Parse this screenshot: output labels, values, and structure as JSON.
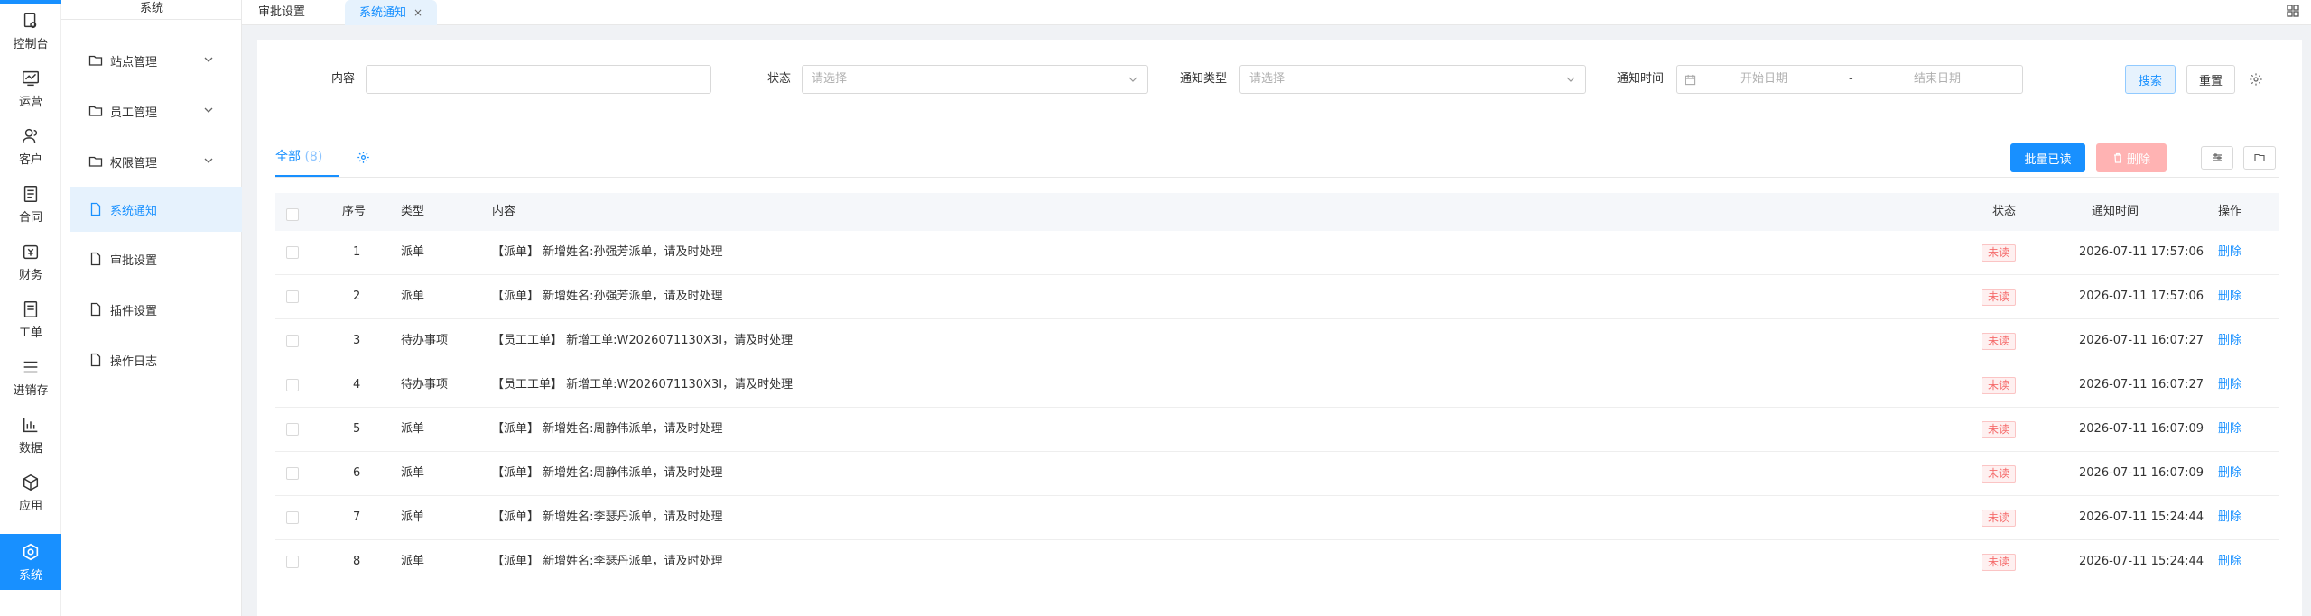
{
  "rail": {
    "items": [
      {
        "label": "控制台",
        "icon": "dashboard-icon"
      },
      {
        "label": "运营",
        "icon": "operations-icon"
      },
      {
        "label": "客户",
        "icon": "customer-icon"
      },
      {
        "label": "合同",
        "icon": "contract-icon"
      },
      {
        "label": "财务",
        "icon": "finance-icon"
      },
      {
        "label": "工单",
        "icon": "workorder-icon"
      },
      {
        "label": "进销存",
        "icon": "inventory-icon"
      },
      {
        "label": "数据",
        "icon": "data-icon"
      },
      {
        "label": "应用",
        "icon": "app-icon"
      },
      {
        "label": "系统",
        "icon": "system-icon"
      }
    ],
    "active_color": "#1890ff"
  },
  "submenu": {
    "title": "系统",
    "items": [
      {
        "label": "站点管理",
        "icon": "folder-icon",
        "expandable": true
      },
      {
        "label": "员工管理",
        "icon": "folder-icon",
        "expandable": true
      },
      {
        "label": "权限管理",
        "icon": "folder-icon",
        "expandable": true
      },
      {
        "label": "系统通知",
        "icon": "document-icon",
        "expandable": false
      },
      {
        "label": "审批设置",
        "icon": "document-icon",
        "expandable": false
      },
      {
        "label": "插件设置",
        "icon": "document-icon",
        "expandable": false
      },
      {
        "label": "操作日志",
        "icon": "document-icon",
        "expandable": false
      }
    ]
  },
  "tabs": [
    {
      "label": "审批设置"
    },
    {
      "label": "系统通知",
      "close": "×"
    }
  ],
  "filters": {
    "content_label": "内容",
    "content_value": "",
    "status_label": "状态",
    "status_placeholder": "请选择",
    "type_label": "通知类型",
    "type_placeholder": "请选择",
    "time_label": "通知时间",
    "start_placeholder": "开始日期",
    "range_sep": "-",
    "end_placeholder": "结束日期",
    "search_label": "搜索",
    "reset_label": "重置"
  },
  "toolbar": {
    "tab_label": "全部",
    "tab_count": "(8)",
    "mark_read_label": "批量已读",
    "delete_label": "删除"
  },
  "table": {
    "headers": {
      "index": "序号",
      "type": "类型",
      "content": "内容",
      "status": "状态",
      "time": "通知时间",
      "action": "操作"
    },
    "rows": [
      {
        "index": "1",
        "type": "派单",
        "content": "【派单】 新增姓名:孙强芳派单，请及时处理",
        "status": "未读",
        "time": "2026-07-11 17:57:06",
        "action": "删除"
      },
      {
        "index": "2",
        "type": "派单",
        "content": "【派单】 新增姓名:孙强芳派单，请及时处理",
        "status": "未读",
        "time": "2026-07-11 17:57:06",
        "action": "删除"
      },
      {
        "index": "3",
        "type": "待办事项",
        "content": "【员工工单】 新增工单:W2026071130X3I，请及时处理",
        "status": "未读",
        "time": "2026-07-11 16:07:27",
        "action": "删除"
      },
      {
        "index": "4",
        "type": "待办事项",
        "content": "【员工工单】 新增工单:W2026071130X3I，请及时处理",
        "status": "未读",
        "time": "2026-07-11 16:07:27",
        "action": "删除"
      },
      {
        "index": "5",
        "type": "派单",
        "content": "【派单】 新增姓名:周静伟派单，请及时处理",
        "status": "未读",
        "time": "2026-07-11 16:07:09",
        "action": "删除"
      },
      {
        "index": "6",
        "type": "派单",
        "content": "【派单】 新增姓名:周静伟派单，请及时处理",
        "status": "未读",
        "time": "2026-07-11 16:07:09",
        "action": "删除"
      },
      {
        "index": "7",
        "type": "派单",
        "content": "【派单】 新增姓名:李瑟丹派单，请及时处理",
        "status": "未读",
        "time": "2026-07-11 15:24:44",
        "action": "删除"
      },
      {
        "index": "8",
        "type": "派单",
        "content": "【派单】 新增姓名:李瑟丹派单，请及时处理",
        "status": "未读",
        "time": "2026-07-11 15:24:44",
        "action": "删除"
      }
    ]
  }
}
